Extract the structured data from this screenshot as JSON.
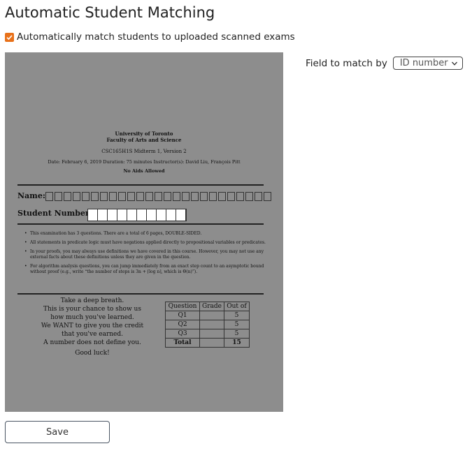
{
  "page": {
    "title": "Automatic Student Matching"
  },
  "auto_match": {
    "label": "Automatically match students to uploaded scanned exams",
    "checked": true
  },
  "field_match": {
    "label": "Field to match by",
    "selected": "ID number"
  },
  "exam": {
    "university": "University of Toronto",
    "faculty": "Faculty of Arts and Science",
    "course": "CSC165H1S   Midterm 1, Version 2",
    "date_line": "Date: February 6, 2019   Duration: 75 minutes   Instructor(s): David Liu, François Pitt",
    "aids": "No Aids Allowed",
    "name_label": "Name:",
    "student_number_label": "Student Number:",
    "bullets": [
      "This examination has 3 questions. There are a total of 6 pages, DOUBLE-SIDED.",
      "All statements in predicate logic must have negations applied directly to propositional variables or predicates.",
      "In your proofs, you may always use definitions we have covered in this course. However, you may not use any external facts about these definitions unless they are given in the question.",
      "For algorithm analysis questions, you can jump immediately from an exact step count to an asymptotic bound without proof (e.g., write “the number of steps is 3n + ⌈log n⌉, which is Θ(n)”)."
    ],
    "breath_lines": [
      "Take a deep breath.",
      "This is your chance to show us",
      "how much you've learned.",
      "We WANT to give you the credit",
      "that you've earned.",
      "A number does not define you.",
      "Good luck!"
    ],
    "grade_table": {
      "headers": [
        "Question",
        "Grade",
        "Out of"
      ],
      "rows": [
        [
          "Q1",
          "",
          "5"
        ],
        [
          "Q2",
          "",
          "5"
        ],
        [
          "Q3",
          "",
          "5"
        ]
      ],
      "total": [
        "Total",
        "",
        "15"
      ]
    }
  },
  "save": {
    "label": "Save"
  },
  "colors": {
    "checkbox": "#e8711a",
    "exam_bg": "#8d8d8d"
  }
}
